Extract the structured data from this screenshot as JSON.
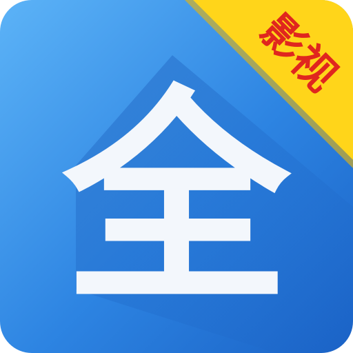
{
  "app_icon": {
    "main_character": "全",
    "badge_label": "影视",
    "colors": {
      "background_light": "#4aa3f0",
      "background_dark": "#1a64c8",
      "shadow": "#1450a8",
      "glyph": "#f3f7fc",
      "badge_fill": "#ffd51a",
      "badge_text": "#e0261e"
    }
  }
}
